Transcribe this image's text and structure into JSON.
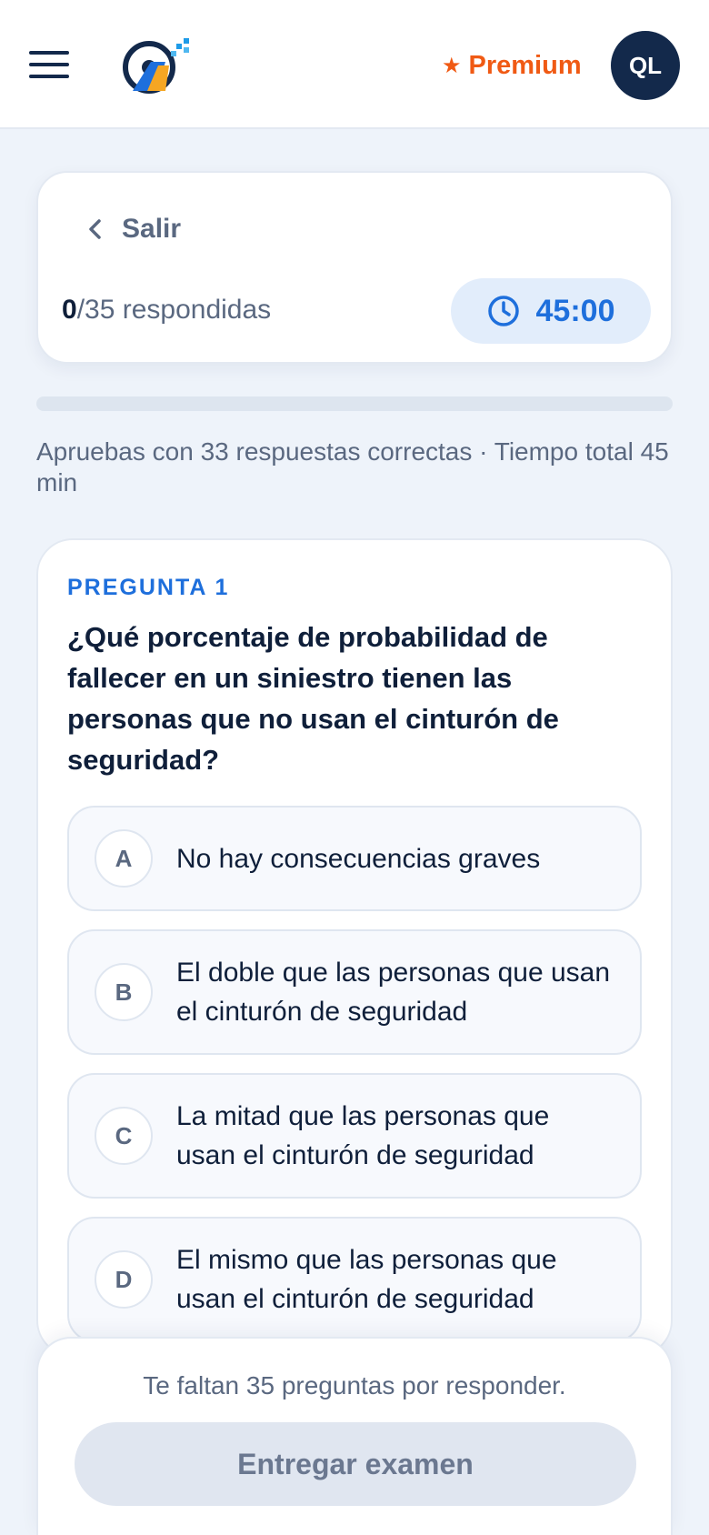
{
  "header": {
    "menu_icon": "hamburger-menu-icon",
    "logo_icon": "steering-wheel-road-logo",
    "premium_star": "★",
    "premium_label": "Premium",
    "avatar_initials": "QL",
    "colors": {
      "brand_dark": "#13294b",
      "premium": "#f05a14",
      "accent": "#1e6fdc"
    }
  },
  "exam": {
    "exit_label": "Salir",
    "answered_count": "0",
    "answered_suffix": "/35 respondidas",
    "timer": "45:00",
    "progress_fraction": 0,
    "info": "Apruebas con 33 respuestas correctas · Tiempo total 45 min"
  },
  "question": {
    "number_label": "PREGUNTA 1",
    "text": "¿Qué porcentaje de probabilidad de fallecer en un siniestro tienen las personas que no usan el cinturón de seguridad?",
    "options": [
      {
        "letter": "A",
        "text": "No hay consecuencias graves"
      },
      {
        "letter": "B",
        "text": "El doble que las personas que usan el cinturón de seguridad"
      },
      {
        "letter": "C",
        "text": "La mitad que las personas que usan el cinturón de seguridad"
      },
      {
        "letter": "D",
        "text": "El mismo que las personas que usan el cinturón de seguridad"
      }
    ]
  },
  "footer": {
    "remaining": "Te faltan 35 preguntas por responder.",
    "submit_label": "Entregar examen"
  }
}
